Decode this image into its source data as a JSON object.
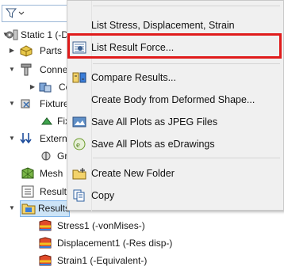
{
  "tree": {
    "root_label": "Static 1 (-D",
    "items": [
      {
        "label": "Parts"
      },
      {
        "label": "Conne"
      },
      {
        "label": "Co"
      },
      {
        "label": "Fixture"
      },
      {
        "label": "Fix"
      },
      {
        "label": "Externa"
      },
      {
        "label": "Gr"
      },
      {
        "label": "Mesh"
      },
      {
        "label": "Result"
      },
      {
        "label": "Results"
      },
      {
        "label": "Stress1 (-vonMises-)"
      },
      {
        "label": "Displacement1 (-Res disp-)"
      },
      {
        "label": "Strain1 (-Equivalent-)"
      }
    ]
  },
  "menu": {
    "items": [
      {
        "label": "List Stress, Displacement, Strain",
        "icon": "none"
      },
      {
        "label": "List Result Force...",
        "icon": "list-result-force-icon"
      },
      {
        "label": "Compare Results...",
        "icon": "compare-results-icon"
      },
      {
        "label": "Create Body from Deformed Shape...",
        "icon": "none"
      },
      {
        "label": "Save All Plots as JPEG Files",
        "icon": "jpeg-icon"
      },
      {
        "label": "Save All Plots as eDrawings",
        "icon": "edrawings-icon"
      },
      {
        "label": "Create New Folder",
        "icon": "new-folder-icon"
      },
      {
        "label": "Copy",
        "icon": "copy-icon"
      }
    ]
  },
  "colors": {
    "highlight": "#e01b1b",
    "selection": "#cce4f7",
    "menu_bg": "#f0f0f0"
  }
}
